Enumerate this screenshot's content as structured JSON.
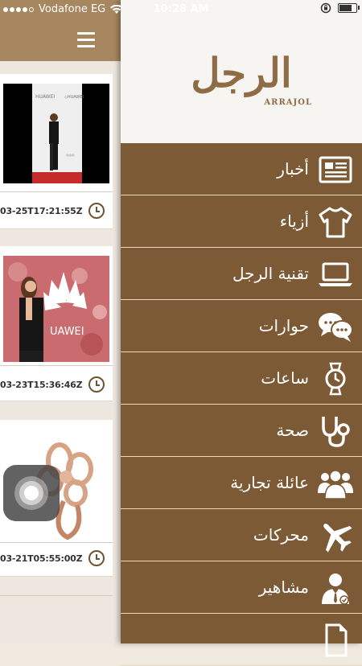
{
  "status_bar": {
    "carrier": "Vodafone EG",
    "time": "10:28 AM",
    "signal_bars": 4,
    "signal_total": 5,
    "battery_level": 0.85
  },
  "feed": {
    "items": [
      {
        "date": "03-25T17:21:55Z",
        "image": "huawei-event-woman-black-dress"
      },
      {
        "date": "03-23T15:36:46Z",
        "image": "huawei-event-woman-flowers"
      },
      {
        "date": "03-21T05:55:00Z",
        "image": "rose-gold-flower-ring"
      }
    ]
  },
  "drawer": {
    "logo_arabic": "الرجل",
    "logo_latin": "ARRAJOL",
    "menu": [
      {
        "label": "أخبار",
        "icon": "newspaper-icon"
      },
      {
        "label": "أزياء",
        "icon": "tshirt-icon"
      },
      {
        "label": "تقنية الرجل",
        "icon": "laptop-icon"
      },
      {
        "label": "حوارات",
        "icon": "chat-bubbles-icon"
      },
      {
        "label": "ساعات",
        "icon": "watch-icon"
      },
      {
        "label": "صحة",
        "icon": "stethoscope-icon"
      },
      {
        "label": "عائلة تجارية",
        "icon": "group-icon"
      },
      {
        "label": "محركات",
        "icon": "airplane-icon"
      },
      {
        "label": "مشاهير",
        "icon": "businessman-icon"
      },
      {
        "label": "",
        "icon": "document-icon"
      }
    ]
  },
  "colors": {
    "brand_brown": "#7c5a35",
    "header_tan": "#a6875f",
    "logo_brown": "#8e6d46"
  }
}
